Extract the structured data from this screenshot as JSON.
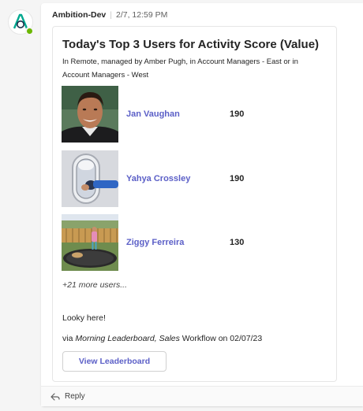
{
  "message": {
    "sender": "Ambition-Dev",
    "timestamp": "2/7, 12:59 PM"
  },
  "card": {
    "title": "Today's Top 3 Users for Activity Score (Value)",
    "subtitle": "In Remote, managed by Amber Pugh, in Account Managers - East or in Account Managers - West",
    "users": [
      {
        "name": "Jan Vaughan",
        "score": "190",
        "photo": "man-smiling-portrait"
      },
      {
        "name": "Yahya Crossley",
        "score": "190",
        "photo": "airplane-window"
      },
      {
        "name": "Ziggy Ferreira",
        "score": "130",
        "photo": "child-on-trampoline"
      }
    ],
    "more_users": "+21 more users...",
    "note": "Looky here!",
    "via_prefix": "via",
    "via_leaderboard": "Morning Leaderboard, Sales",
    "via_suffix": "Workflow on 02/07/23",
    "button_label": "View Leaderboard"
  },
  "reply": {
    "label": "Reply"
  },
  "colors": {
    "accent": "#5b5fc7",
    "presence": "#6bb700",
    "logo_green": "#00a88f"
  }
}
